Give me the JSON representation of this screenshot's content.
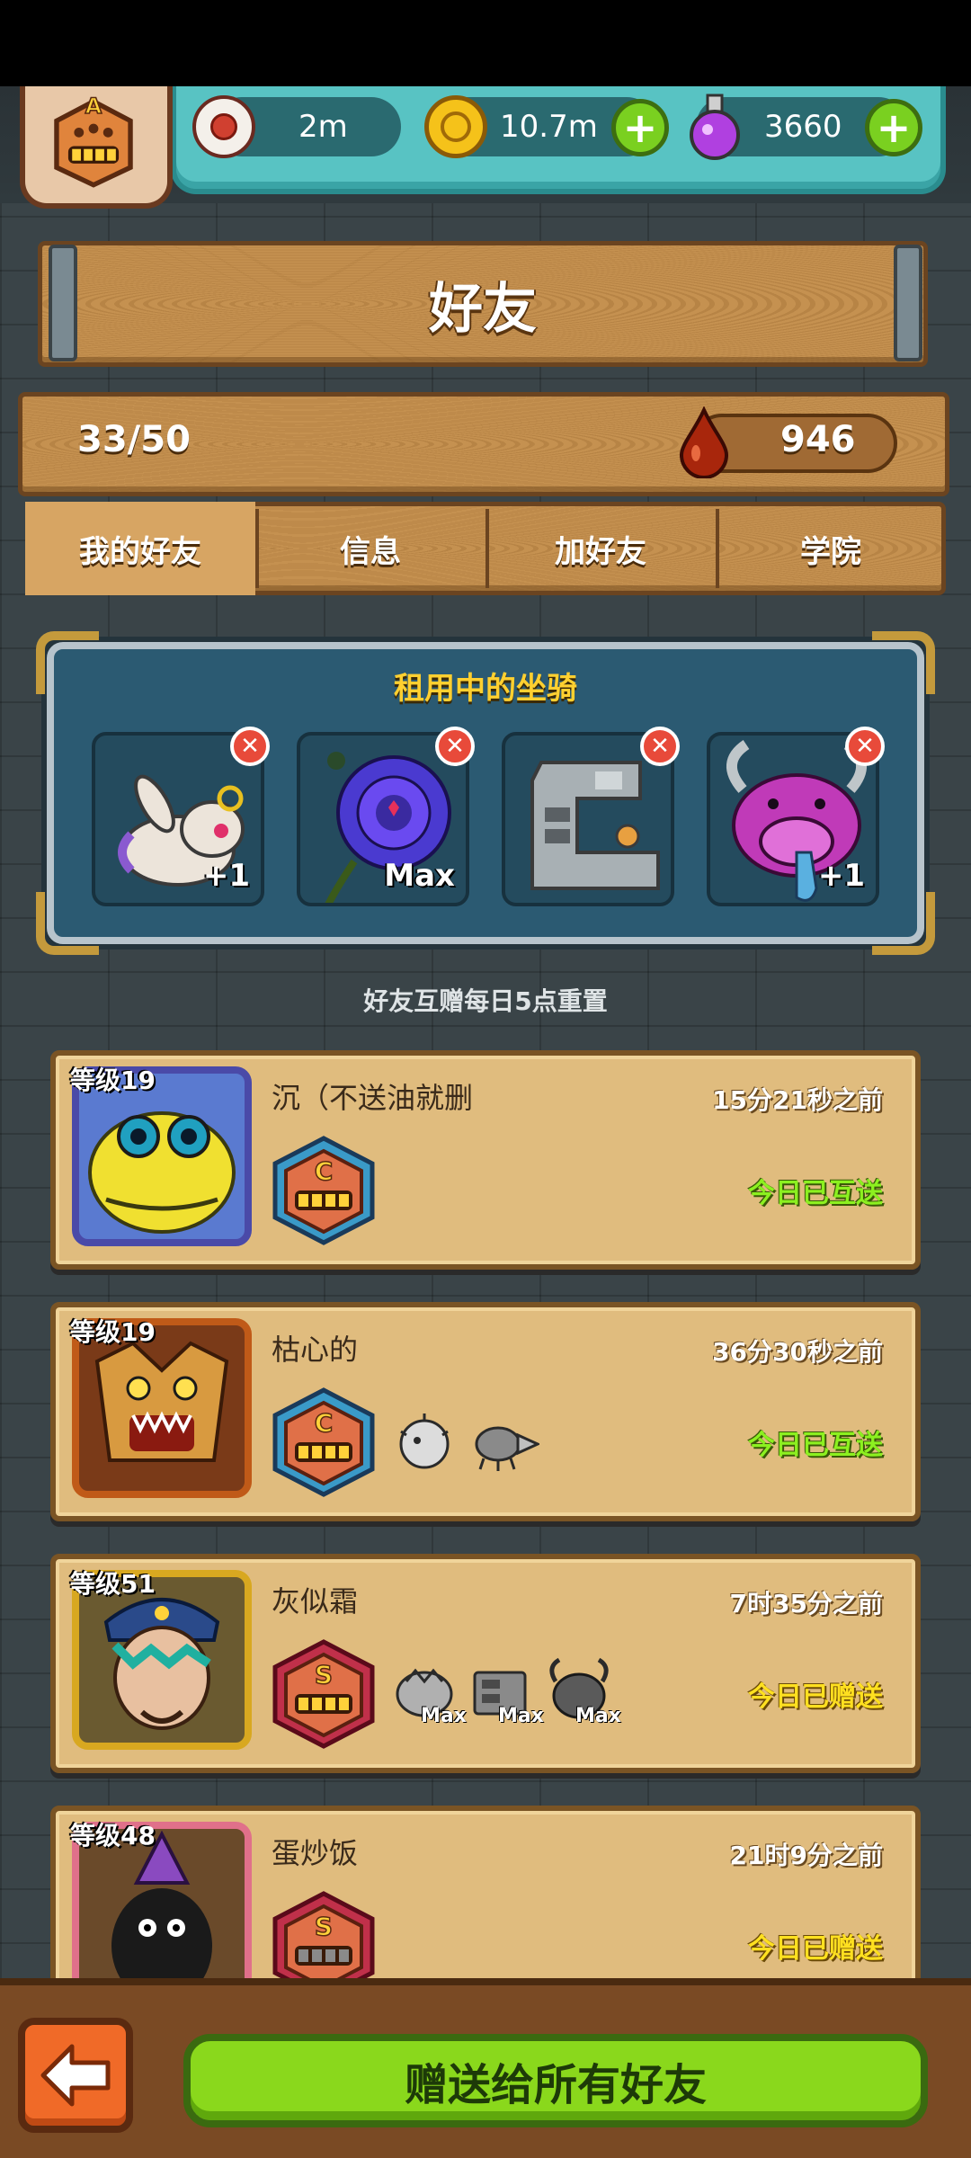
{
  "resources": {
    "eye_value": "2m",
    "coin_value": "10.7m",
    "potion_value": "3660",
    "rank_letter": "A"
  },
  "header": {
    "title": "好友"
  },
  "stats": {
    "friend_count": "33/50",
    "blood_value": "946"
  },
  "tabs": [
    {
      "label": "我的好友",
      "active": true
    },
    {
      "label": "信息",
      "active": false
    },
    {
      "label": "加好友",
      "active": false
    },
    {
      "label": "学院",
      "active": false
    }
  ],
  "rented_mounts": {
    "title": "租用中的坐骑",
    "slots": [
      {
        "name": "rabbit",
        "tag": "+1"
      },
      {
        "name": "rose",
        "tag": "Max"
      },
      {
        "name": "machine",
        "tag": ""
      },
      {
        "name": "horned-beast",
        "tag": "+1"
      }
    ]
  },
  "reset_note": "好友互赠每日5点重置",
  "friends": [
    {
      "level": "等级19",
      "name": "沉（不送油就删",
      "time": "15分21秒之前",
      "status": "今日已互送",
      "rank": "C",
      "mounts": []
    },
    {
      "level": "等级19",
      "name": "枯心的",
      "time": "36分30秒之前",
      "status": "今日已互送",
      "rank": "C",
      "mounts": [
        {
          "tag": ""
        },
        {
          "tag": ""
        }
      ]
    },
    {
      "level": "等级51",
      "name": "灰似霜",
      "time": "7时35分之前",
      "status": "今日已赠送",
      "rank": "S",
      "mounts": [
        {
          "tag": "Max"
        },
        {
          "tag": "Max"
        },
        {
          "tag": "Max"
        }
      ]
    },
    {
      "level": "等级48",
      "name": "蛋炒饭",
      "time": "21时9分之前",
      "status": "今日已赠送",
      "rank": "S",
      "mounts": []
    }
  ],
  "actions": {
    "gift_all_label": "赠送给所有好友"
  }
}
